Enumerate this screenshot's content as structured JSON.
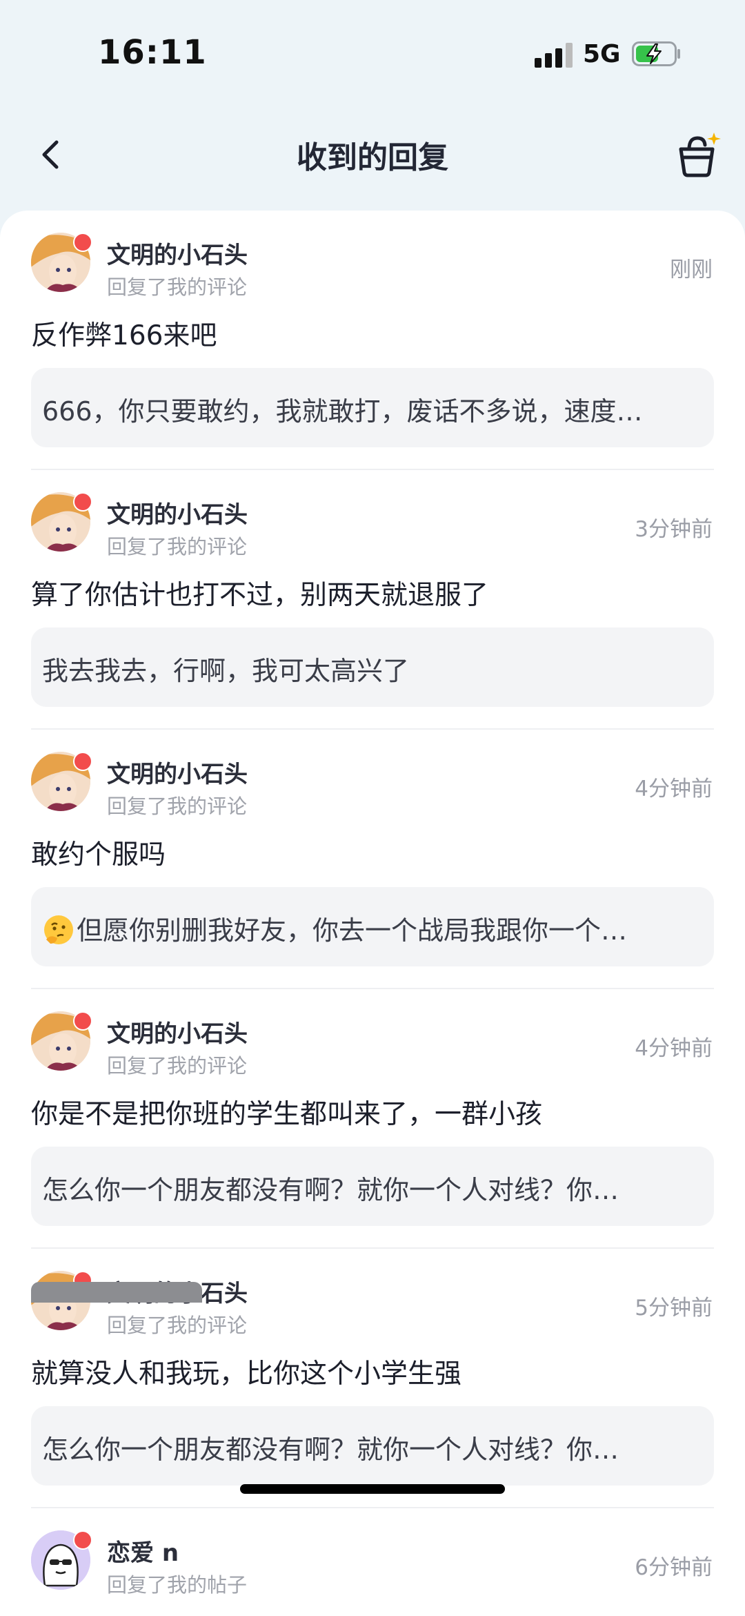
{
  "status_bar": {
    "time": "16:11",
    "network": "5G"
  },
  "nav": {
    "title": "收到的回复"
  },
  "replies": [
    {
      "user": "文明的小石头",
      "action": "回复了我的评论",
      "time": "刚刚",
      "text": "反作弊166来吧",
      "quote": "666，你只要敢约，我就敢打，废话不多说，速度…"
    },
    {
      "user": "文明的小石头",
      "action": "回复了我的评论",
      "time": "3分钟前",
      "text": "算了你估计也打不过，别两天就退服了",
      "quote": "我去我去，行啊，我可太高兴了"
    },
    {
      "user": "文明的小石头",
      "action": "回复了我的评论",
      "time": "4分钟前",
      "text": "敢约个服吗",
      "quote": "但愿你别删我好友，你去一个战局我跟你一个…",
      "quote_emoji": "thinking-face-icon"
    },
    {
      "user": "文明的小石头",
      "action": "回复了我的评论",
      "time": "4分钟前",
      "text": "你是不是把你班的学生都叫来了，一群小孩",
      "quote": "怎么你一个朋友都没有啊？就你一个人对线？你…"
    },
    {
      "user": "文明的小石头",
      "action": "回复了我的评论",
      "time": "5分钟前",
      "text": "就算没人和我玩，比你这个小学生强",
      "quote": "怎么你一个朋友都没有啊？就你一个人对线？你…"
    }
  ],
  "last_item": {
    "user": "恋爱 n",
    "action": "回复了我的帖子",
    "time": "6分钟前"
  },
  "colors": {
    "background": "#edf4f8",
    "unread_dot": "#f24c4c",
    "battery_fill": "#36c24a"
  }
}
